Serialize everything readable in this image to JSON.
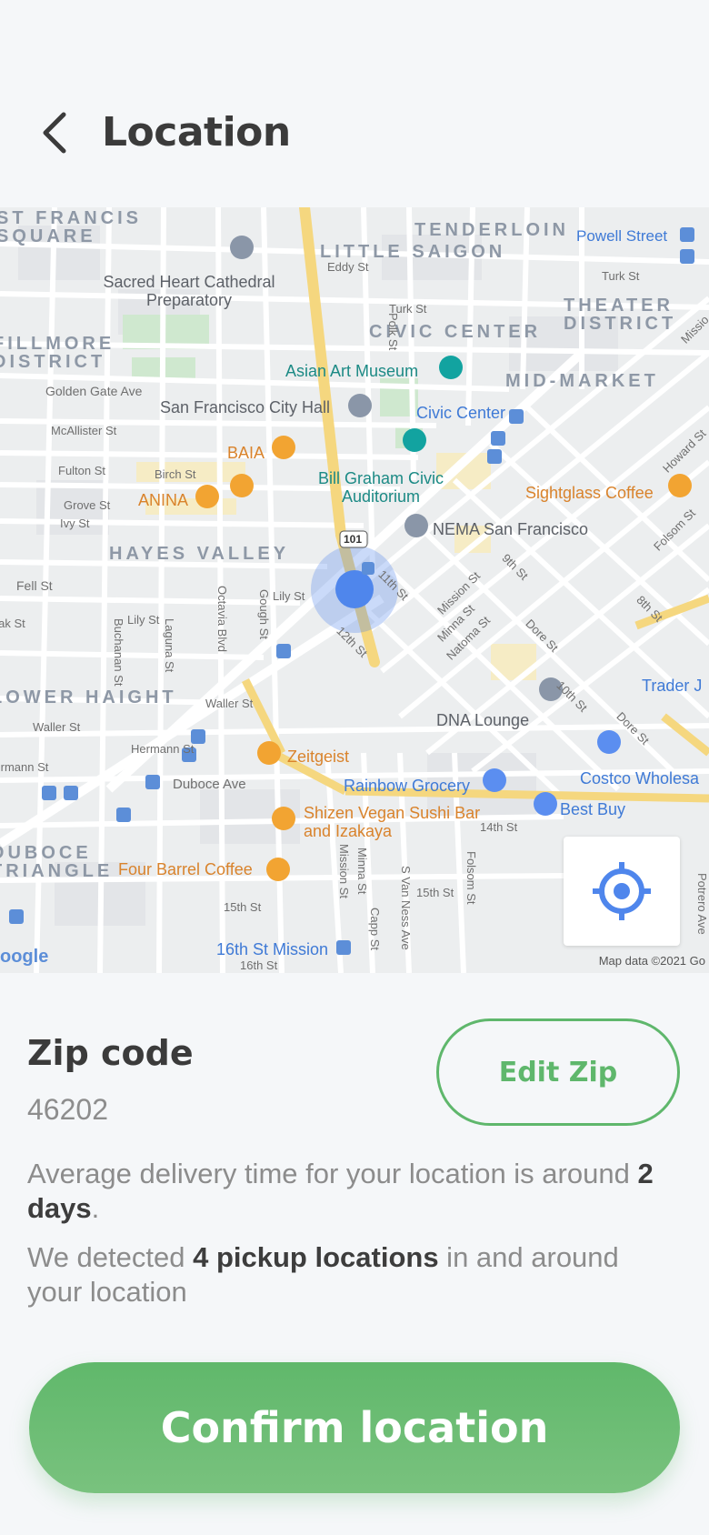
{
  "header": {
    "title": "Location",
    "back_icon": "chevron-left-icon"
  },
  "map": {
    "districts": [
      "ST FRANCIS SQUARE",
      "TENDERLOIN",
      "LITTLE SAIGON",
      "THEATER DISTRICT",
      "FILLMORE DISTRICT",
      "CIVIC CENTER",
      "MID-MARKET",
      "HAYES VALLEY",
      "LOWER HAIGHT",
      "DUBOCE TRIANGLE"
    ],
    "pois": {
      "sacred_heart": "Sacred Heart Cathedral Preparatory",
      "powell": "Powell Street",
      "asian_art": "Asian Art Museum",
      "city_hall": "San Francisco City Hall",
      "civic_center": "Civic Center",
      "baia": "BAIA",
      "anina": "ANINA",
      "bill_graham": "Bill Graham Civic Auditorium",
      "sightglass": "Sightglass Coffee",
      "nema": "NEMA San Francisco",
      "trader": "Trader J",
      "dna": "DNA Lounge",
      "zeitgeist": "Zeitgeist",
      "rainbow": "Rainbow Grocery",
      "costco": "Costco Wholesa",
      "best_buy": "Best Buy",
      "shizen": "Shizen Vegan Sushi Bar and Izakaya",
      "four_barrel": "Four Barrel Coffee",
      "mission_16th": "16th St Mission"
    },
    "streets": {
      "eddy": "Eddy St",
      "turk": "Turk St",
      "turk2": "Turk St",
      "golden_gate": "Golden Gate Ave",
      "mcallister": "McAllister St",
      "fulton": "Fulton St",
      "birch": "Birch St",
      "grove": "Grove St",
      "ivy": "Ivy St",
      "fell": "Fell St",
      "oak": "Oak St",
      "lily": "Lily St",
      "lily2": "Lily St",
      "waller": "Waller St",
      "waller2": "Waller St",
      "hermann": "Hermann St",
      "hermann2": "Hermann St",
      "duboce": "Duboce Ave",
      "octavia": "Octavia Blvd",
      "gough": "Gough St",
      "polk": "Polk St",
      "buchanan": "Buchanan St",
      "laguna": "Laguna St",
      "mission_st": "Mission St",
      "mission_v": "Mission St",
      "minna": "Minna St",
      "minna_v": "Minna St",
      "natoma": "Natoma St",
      "capp": "Capp St",
      "s_van_ness": "S Van Ness Ave",
      "folsom": "Folsom St",
      "folsom_v": "Folsom St",
      "howard": "Howard St",
      "ninth": "9th St",
      "eighth": "8th St",
      "tenth": "10th St",
      "eleventh": "11th St",
      "twelfth": "12th St",
      "dore": "Dore St",
      "dore2": "Dore St",
      "fourteenth": "14th St",
      "fifteenth": "15th St",
      "fifteenth2": "15th St",
      "sixteenth": "16th St",
      "potrero": "Potrero Ave",
      "mission_diag": "Missio",
      "highway": "101"
    },
    "attribution": "Map data ©2021 Go",
    "logo_text": "oogle",
    "locate_icon": "crosshair-target-icon",
    "user_marker_icon": "current-location-dot-icon"
  },
  "zip": {
    "title": "Zip code",
    "value": "46202",
    "edit_label": "Edit Zip"
  },
  "info": {
    "delivery_prefix": "Average delivery time for your location is around ",
    "delivery_bold": "2 days",
    "delivery_suffix": ".",
    "pickup_prefix": "We detected ",
    "pickup_bold": "4 pickup locations",
    "pickup_suffix": " in and around your location"
  },
  "confirm": {
    "label": "Confirm location"
  },
  "colors": {
    "accent": "#5fb76c",
    "map_location": "#4f86ec",
    "background": "#f5f7f9"
  }
}
